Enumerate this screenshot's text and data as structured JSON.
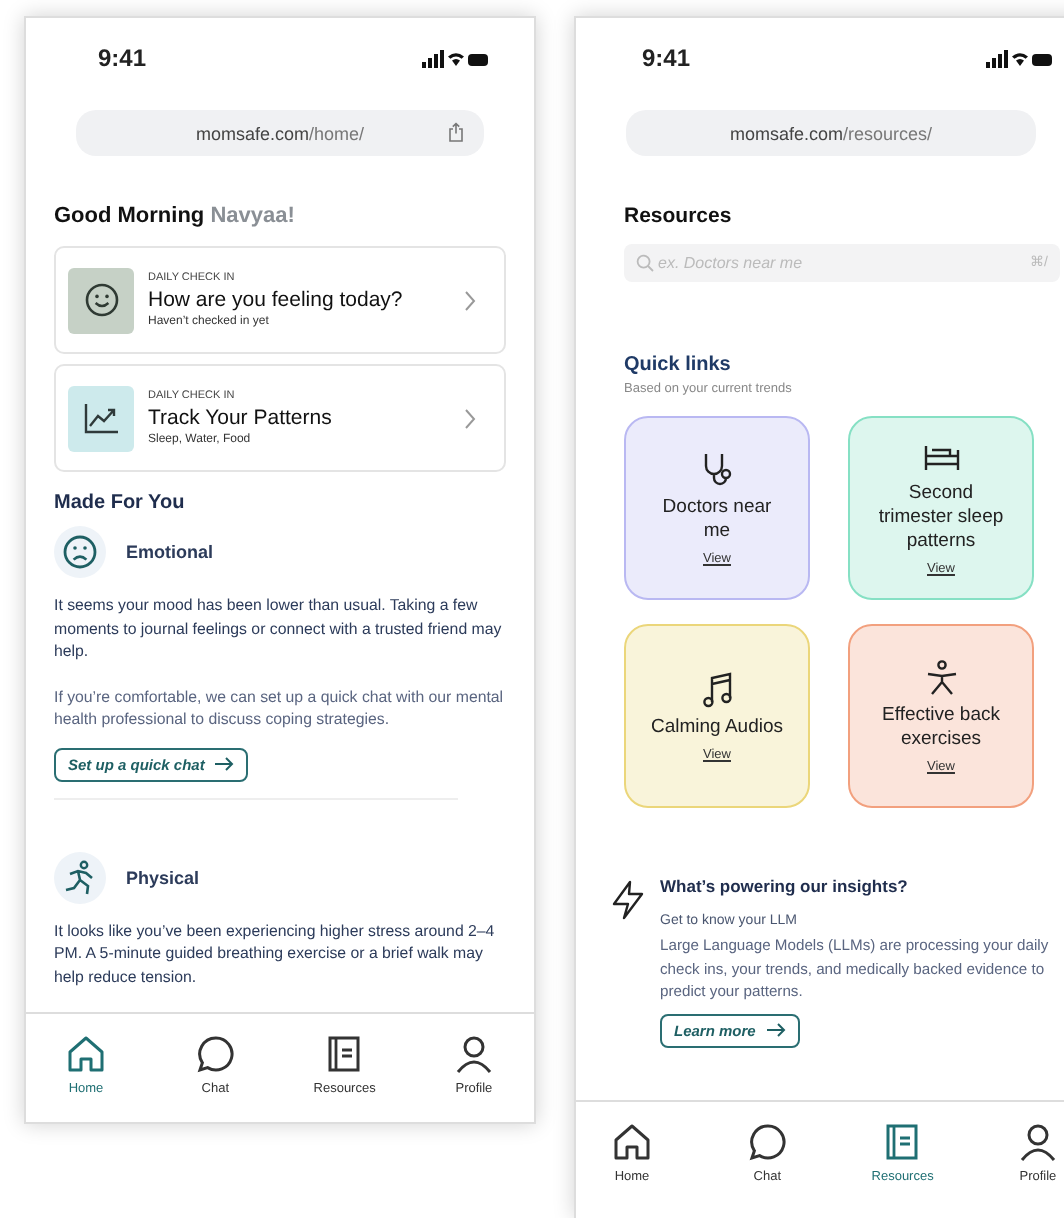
{
  "home": {
    "time": "9:41",
    "url": {
      "domain": "momsafe.com",
      "path": "/home/"
    },
    "greeting": {
      "text": "Good Morning",
      "name": "Navyaa!"
    },
    "checkins": [
      {
        "kicker": "DAILY CHECK IN",
        "title": "How are you feeling today?",
        "subtitle": "Haven’t checked in yet",
        "color": "#c6d1c6"
      },
      {
        "kicker": "DAILY CHECK IN",
        "title": "Track Your Patterns",
        "subtitle": "Sleep, Water, Food",
        "color": "#cdeaec"
      }
    ],
    "section_title": "Made For You",
    "insights": [
      {
        "title": "Emotional",
        "paragraphs": [
          "It seems your mood has been lower than usual. Taking a few moments to journal feelings or connect with a trusted friend may help.",
          "If you’re comfortable, we can set up a quick chat with our mental health professional to discuss coping strategies."
        ],
        "button": "Set up a quick chat"
      },
      {
        "title": "Physical",
        "paragraphs": [
          "It looks like you’ve been experiencing higher stress around 2–4 PM. A 5-minute guided breathing exercise or a brief walk may help reduce tension."
        ]
      }
    ],
    "nav": [
      {
        "label": "Home",
        "selected": true
      },
      {
        "label": "Chat",
        "selected": false
      },
      {
        "label": "Resources",
        "selected": false
      },
      {
        "label": "Profile",
        "selected": false
      }
    ]
  },
  "resources": {
    "time": "9:41",
    "url": {
      "domain": "momsafe.com",
      "path": "/resources/"
    },
    "title": "Resources",
    "search": {
      "placeholder": "ex. Doctors near me",
      "shortcut": "⌘/"
    },
    "quick_links": {
      "title": "Quick links",
      "subtitle": "Based on your current trends",
      "items": [
        {
          "label": "Doctors near me",
          "link": "View",
          "color": "#b9b8f2"
        },
        {
          "label": "Second trimester sleep patterns",
          "link": "View",
          "color": "#86e0c4"
        },
        {
          "label": "Calming Audios",
          "link": "View",
          "color": "#ebd67a"
        },
        {
          "label": "Effective back exercises",
          "link": "View",
          "color": "#f2a07e"
        }
      ]
    },
    "insights": {
      "title": "What’s powering our insights?",
      "subtitle": "Get to know your LLM",
      "body": "Large Language Models (LLMs) are processing your daily check ins, your trends, and medically backed evidence to predict your patterns.",
      "button": "Learn more"
    },
    "nav": [
      {
        "label": "Home",
        "selected": false
      },
      {
        "label": "Chat",
        "selected": false
      },
      {
        "label": "Resources",
        "selected": true
      },
      {
        "label": "Profile",
        "selected": false
      }
    ]
  }
}
